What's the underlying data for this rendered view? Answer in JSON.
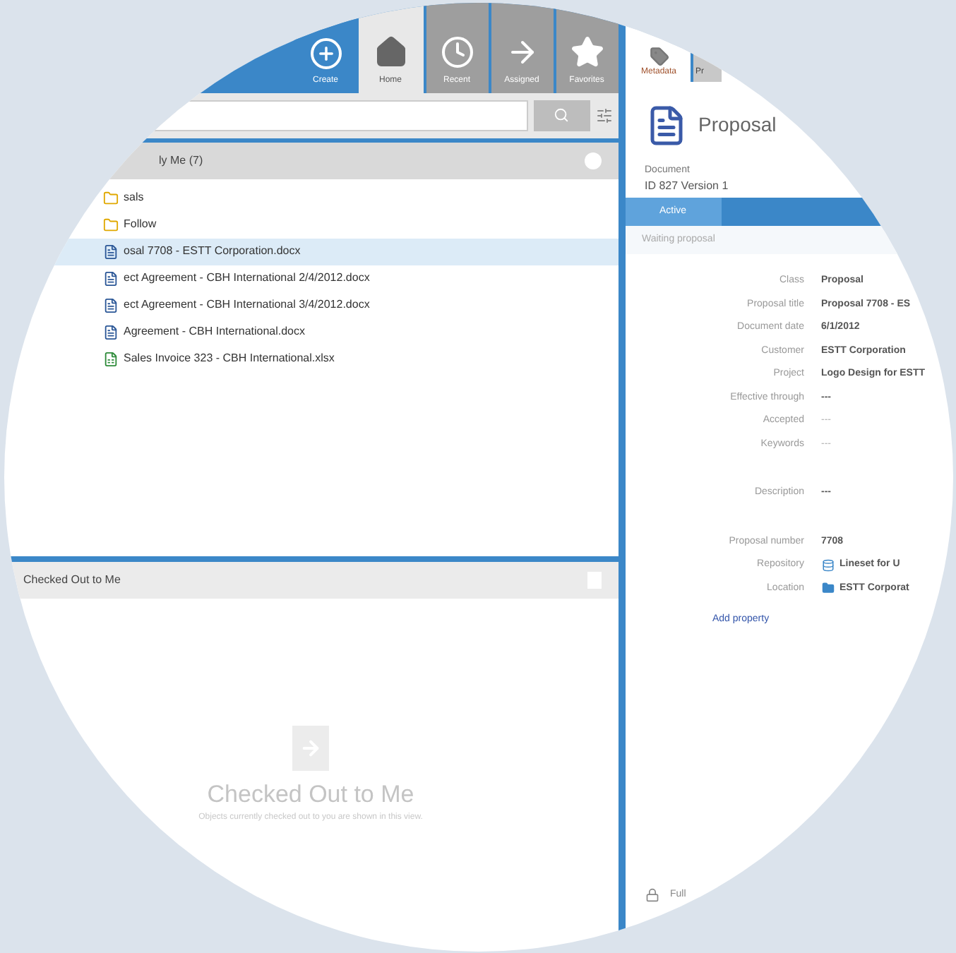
{
  "top_tabs": [
    {
      "label": "Create",
      "kind": "create",
      "selected": false
    },
    {
      "label": "Home",
      "kind": "home",
      "selected": true
    },
    {
      "label": "Recent",
      "kind": "recent",
      "selected": false
    },
    {
      "label": "Assigned",
      "kind": "assigned",
      "selected": false
    },
    {
      "label": "Favorites",
      "kind": "favorites",
      "selected": false
    }
  ],
  "recent_section": {
    "title": "ly Me (7)",
    "items": [
      {
        "label": "sals",
        "selected": false,
        "kind": "folder"
      },
      {
        "label": "Follow",
        "selected": false,
        "kind": "folder"
      },
      {
        "label": "osal 7708 - ESTT Corporation.docx",
        "selected": true,
        "kind": "doc"
      },
      {
        "label": "ect Agreement - CBH International 2/4/2012.docx",
        "selected": false,
        "kind": "doc"
      },
      {
        "label": "ect Agreement - CBH International 3/4/2012.docx",
        "selected": false,
        "kind": "doc"
      },
      {
        "label": "Agreement - CBH International.docx",
        "selected": false,
        "kind": "doc"
      },
      {
        "label": "Sales Invoice 323 - CBH International.xlsx",
        "selected": false,
        "kind": "xls"
      }
    ]
  },
  "checked_out_section": {
    "title": "Checked Out to Me",
    "empty_title": "Checked Out to Me",
    "empty_text": "Objects currently checked out to you are shown in this view."
  },
  "right_tabs": [
    {
      "label": "Metadata",
      "selected": true
    },
    {
      "label": "Pr",
      "selected": false
    }
  ],
  "object": {
    "title": "Proposal",
    "type": "Document",
    "id": "ID 827 Version 1",
    "workflow_state": "Active",
    "workflow_note": "Waiting proposal"
  },
  "properties": [
    {
      "label": "Class",
      "value": "Proposal",
      "kind": "text"
    },
    {
      "label": "Proposal title",
      "value": "Proposal 7708 - ES",
      "kind": "text"
    },
    {
      "label": "Document date",
      "value": "6/1/2012",
      "kind": "text"
    },
    {
      "label": "Customer",
      "value": "ESTT Corporation",
      "kind": "link"
    },
    {
      "label": "Project",
      "value": "Logo Design for ESTT",
      "kind": "text"
    },
    {
      "label": "Effective through",
      "value": "---",
      "kind": "text"
    },
    {
      "label": "Accepted",
      "value": "---",
      "kind": "faded"
    },
    {
      "label": "Keywords",
      "value": "---",
      "kind": "faded"
    },
    {
      "label": "Description",
      "value": "---",
      "kind": "text"
    },
    {
      "label": "Proposal number",
      "value": "7708",
      "kind": "text"
    },
    {
      "label": "Repository",
      "value": "Lineset for U",
      "kind": "repo"
    },
    {
      "label": "Location",
      "value": "ESTT Corporat",
      "kind": "folder"
    }
  ],
  "add_property": "Add property",
  "footer": {
    "label": "Full"
  }
}
